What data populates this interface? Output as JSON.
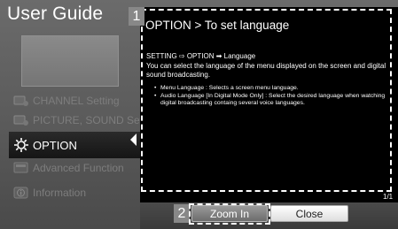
{
  "header": {
    "title": "User Guide"
  },
  "menu": {
    "items": [
      {
        "label": "CHANNEL Setting",
        "icon": "channel-icon",
        "active": false
      },
      {
        "label": "PICTURE, SOUND Setting",
        "icon": "picture-sound-icon",
        "active": false
      },
      {
        "label": "OPTION",
        "icon": "gear-icon",
        "active": true
      },
      {
        "label": "Advanced Function",
        "icon": "advanced-function-icon",
        "active": false
      },
      {
        "label": "Information",
        "icon": "information-icon",
        "active": false
      }
    ]
  },
  "callouts": {
    "one": "1",
    "two": "2"
  },
  "content": {
    "title": "OPTION > To set language",
    "path": "SETTING ⇨ OPTION ➡ Language",
    "description": "You can select the language of the menu displayed on the screen and digital sound broadcasting.",
    "bullets": [
      "Menu Language : Selects a screen menu language.",
      "Audio Language  [In Digital Mode Only] : Select the desired language when watching digital broadcasting containg several voice languages."
    ],
    "page_indicator": "1/1"
  },
  "buttons": {
    "zoom_in": "Zoom In",
    "close": "Close"
  },
  "colors": {
    "active_menu_bg": "#151515",
    "content_bg": "#000000",
    "close_button_bg": "#ffffff"
  }
}
